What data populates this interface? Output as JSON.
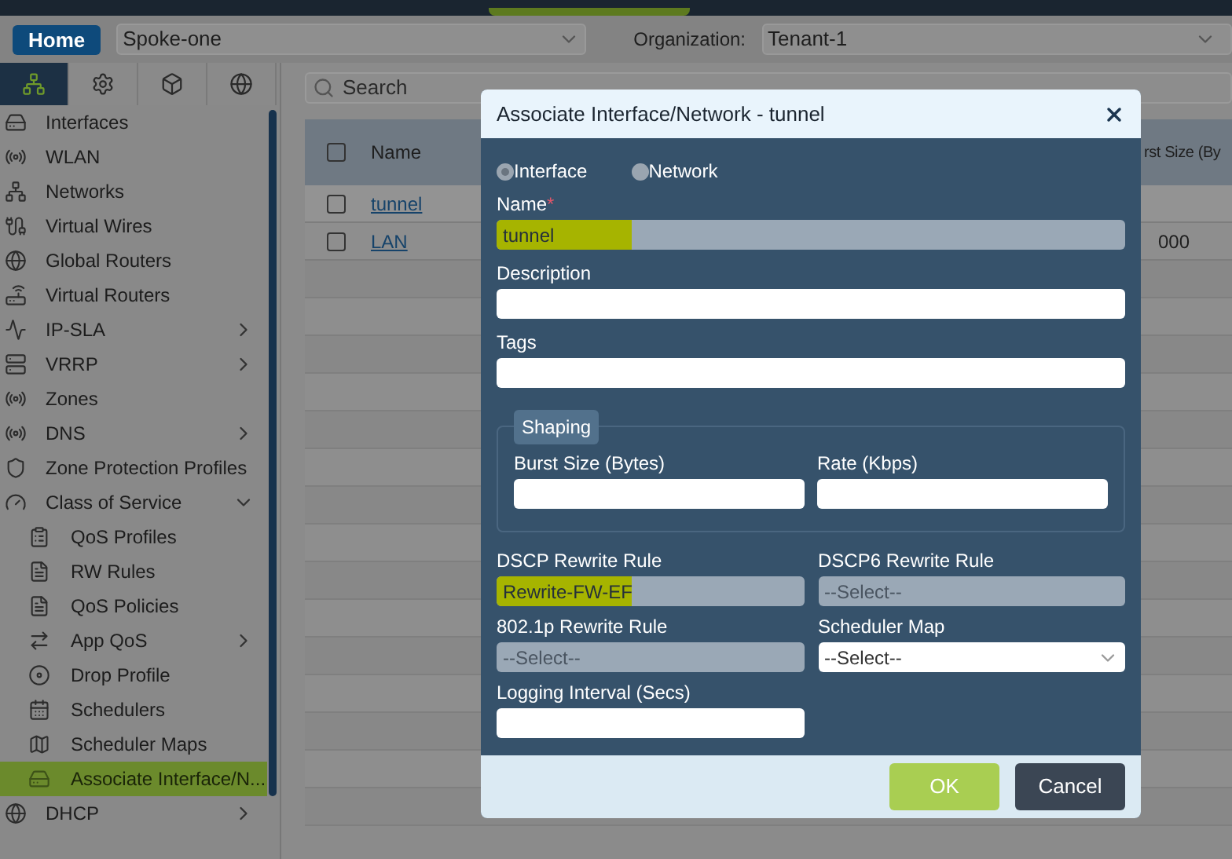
{
  "header": {
    "home_button": "Home",
    "device_select": "Spoke-one",
    "organization_label": "Organization:",
    "organization_select": "Tenant-1"
  },
  "sidebar": {
    "tabs": [
      {
        "selected": true
      },
      {
        "selected": false
      },
      {
        "selected": false
      },
      {
        "selected": false
      }
    ],
    "items": [
      {
        "label": "Interfaces",
        "selected": false
      },
      {
        "label": "WLAN",
        "selected": false
      },
      {
        "label": "Networks",
        "selected": false
      },
      {
        "label": "Virtual Wires",
        "selected": false
      },
      {
        "label": "Global Routers",
        "selected": false
      },
      {
        "label": "Virtual Routers",
        "selected": false
      },
      {
        "label": "IP-SLA",
        "selected": false,
        "expanded": false
      },
      {
        "label": "VRRP",
        "selected": false,
        "expanded": false
      },
      {
        "label": "Zones",
        "selected": false
      },
      {
        "label": "DNS",
        "selected": false,
        "expanded": false
      },
      {
        "label": "Zone Protection Profiles",
        "selected": false
      },
      {
        "label": "Class of Service",
        "selected": false,
        "expanded": true,
        "children": [
          {
            "label": "QoS Profiles",
            "selected": false
          },
          {
            "label": "RW Rules",
            "selected": false
          },
          {
            "label": "QoS Policies",
            "selected": false
          },
          {
            "label": "App QoS",
            "selected": false,
            "expanded": false
          },
          {
            "label": "Drop Profile",
            "selected": false
          },
          {
            "label": "Schedulers",
            "selected": false
          },
          {
            "label": "Scheduler Maps",
            "selected": false
          },
          {
            "label": "Associate Interface/N...",
            "selected": true
          }
        ]
      },
      {
        "label": "DHCP",
        "selected": false,
        "expanded": false
      }
    ]
  },
  "search": {
    "placeholder": "Search"
  },
  "table": {
    "select_all_checked": false,
    "columns": [
      "Name",
      "rst Size (By"
    ],
    "rows": [
      {
        "checked": false,
        "name": "tunnel"
      },
      {
        "checked": false,
        "name": "LAN",
        "column_2": "000"
      }
    ]
  },
  "dialog": {
    "title": "Associate Interface/Network - tunnel",
    "radios": [
      {
        "label": "Interface",
        "selected": true
      },
      {
        "label": "Network",
        "selected": false
      }
    ],
    "name": {
      "label": "Name",
      "required_mark": "*",
      "value": "tunnel",
      "disabled": true,
      "highlighted": true
    },
    "description": {
      "label": "Description"
    },
    "tags": {
      "label": "Tags"
    },
    "shaping": {
      "legend": "Shaping",
      "fields": [
        {
          "label": "Burst Size (Bytes)"
        },
        {
          "label": "Rate (Kbps)"
        }
      ]
    },
    "grid_fields": [
      {
        "label": "DSCP Rewrite Rule",
        "value": "Rewrite-FW-EF",
        "kind": "input",
        "disabled": true,
        "highlighted": true
      },
      {
        "label": "DSCP6 Rewrite Rule",
        "placeholder": "--Select--",
        "kind": "input",
        "disabled": true,
        "highlighted": false
      },
      {
        "label": "802.1p Rewrite Rule",
        "placeholder": "--Select--",
        "kind": "input",
        "disabled": true,
        "highlighted": false
      },
      {
        "label": "Scheduler Map",
        "placeholder": "--Select--",
        "kind": "select",
        "disabled": false,
        "highlighted": false
      },
      {
        "label": "Logging Interval (Secs)",
        "kind": "input",
        "disabled": false,
        "highlighted": false
      }
    ],
    "buttons": [
      {
        "label": "OK",
        "kind": "primary"
      },
      {
        "label": "Cancel",
        "kind": "secondary"
      }
    ]
  }
}
